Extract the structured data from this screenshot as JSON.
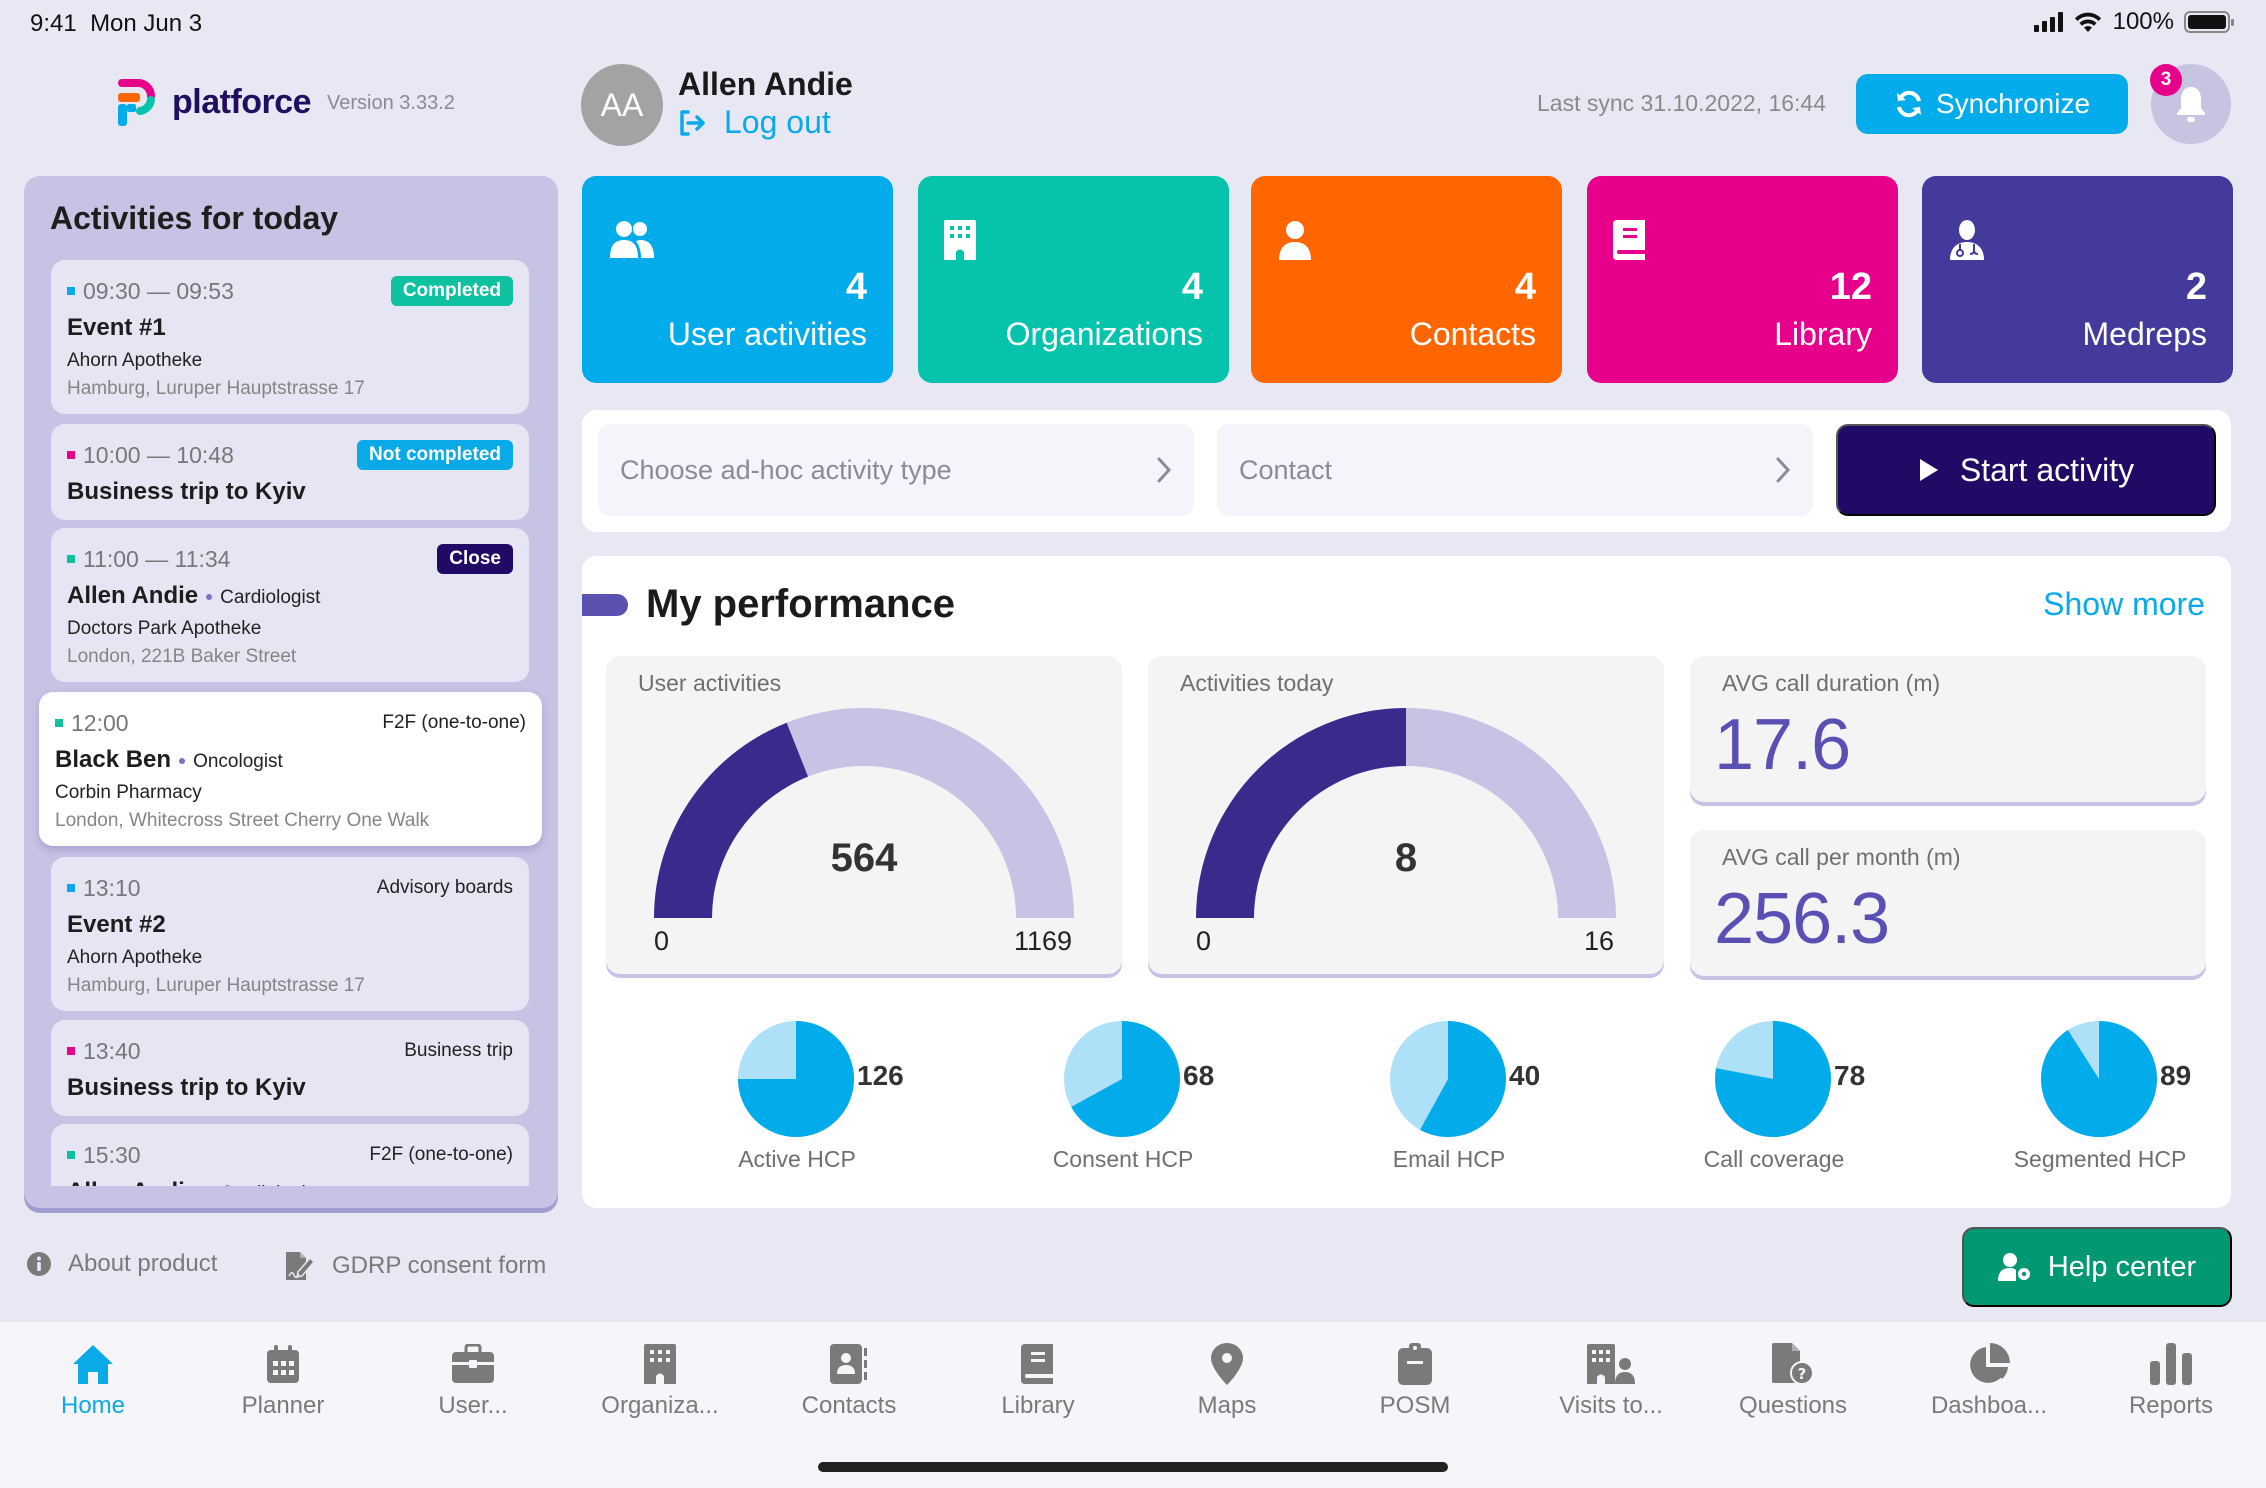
{
  "status_bar": {
    "time": "9:41",
    "date": "Mon Jun 3",
    "battery": "100%"
  },
  "header": {
    "brand": "platforce",
    "version": "Version 3.33.2",
    "user_initials": "AA",
    "user_name": "Allen Andie",
    "logout_label": "Log out",
    "last_sync": "Last sync 31.10.2022, 16:44",
    "sync_label": "Synchronize",
    "notification_count": "3"
  },
  "activities_panel": {
    "title": "Activities for today",
    "items": [
      {
        "time": "09:30 — 09:53",
        "color": "#0aa9e8",
        "badge": "Completed",
        "badge_color": "#0ec2a1",
        "title": "Event #1",
        "specialty": "",
        "org": "Ahorn Apotheke",
        "address": "Hamburg, Luruper Hauptstrasse 17"
      },
      {
        "time": "10:00 — 10:48",
        "color": "#e6008a",
        "badge": "Not completed",
        "badge_color": "#0aa9e8",
        "title": "Business trip to Kyiv",
        "specialty": "",
        "org": "",
        "address": ""
      },
      {
        "time": "11:00 — 11:34",
        "color": "#0ec2a1",
        "badge": "Close",
        "badge_color": "#210a66",
        "title": "Allen Andie",
        "specialty": "Cardiologist",
        "org": "Doctors Park Apotheke",
        "address": "London, 221B Baker Street"
      },
      {
        "time": "12:00",
        "color": "#0ec2a1",
        "type": "F2F (one-to-one)",
        "title": "Black Ben",
        "specialty": "Oncologist",
        "org": "Corbin Pharmacy",
        "address": "London, Whitecross Street Cherry One Walk",
        "selected": true
      },
      {
        "time": "13:10",
        "color": "#0aa9e8",
        "type": "Advisory boards",
        "title": "Event #2",
        "specialty": "",
        "org": "Ahorn Apotheke",
        "address": "Hamburg, Luruper Hauptstrasse 17"
      },
      {
        "time": "13:40",
        "color": "#e6008a",
        "type": "Business trip",
        "title": "Business trip to Kyiv",
        "specialty": "",
        "org": "",
        "address": ""
      },
      {
        "time": "15:30",
        "color": "#0ec2a1",
        "type": "F2F (one-to-one)",
        "title": "Allen Andie",
        "specialty": "Cardiologist",
        "org": "",
        "address": ""
      }
    ]
  },
  "tiles": [
    {
      "icon": "users-icon",
      "count": "4",
      "label": "User activities",
      "color": "#02abe9"
    },
    {
      "icon": "building-icon",
      "count": "4",
      "label": "Organizations",
      "color": "#06c4ab"
    },
    {
      "icon": "user-icon",
      "count": "4",
      "label": "Contacts",
      "color": "#ff6600"
    },
    {
      "icon": "book-icon",
      "count": "12",
      "label": "Library",
      "color": "#e6008a"
    },
    {
      "icon": "doctor-icon",
      "count": "2",
      "label": "Medreps",
      "color": "#433a9b"
    }
  ],
  "action_bar": {
    "activity_type_placeholder": "Choose ad-hoc activity type",
    "contact_placeholder": "Contact",
    "start_label": "Start activity"
  },
  "performance": {
    "title": "My performance",
    "show_more": "Show more",
    "metrics": [
      {
        "label": "AVG call duration (m)",
        "value": "17.6"
      },
      {
        "label": "AVG call per month (m)",
        "value": "256.3"
      }
    ]
  },
  "chart_data": [
    {
      "type": "gauge",
      "title": "User activities",
      "value": 564,
      "min": 0,
      "max": 1169,
      "min_label": "0",
      "max_label": "1169",
      "value_label": "564",
      "displayed_fill_fraction": 0.38
    },
    {
      "type": "gauge",
      "title": "Activities today",
      "value": 8,
      "min": 0,
      "max": 16,
      "min_label": "0",
      "max_label": "16",
      "value_label": "8",
      "displayed_fill_fraction": 0.5
    },
    {
      "type": "pie",
      "title": "Active HCP",
      "value_label": "126",
      "filled_fraction": 0.75
    },
    {
      "type": "pie",
      "title": "Consent HCP",
      "value_label": "68",
      "filled_fraction": 0.67
    },
    {
      "type": "pie",
      "title": "Email HCP",
      "value_label": "40",
      "filled_fraction": 0.58
    },
    {
      "type": "pie",
      "title": "Call coverage",
      "value_label": "78",
      "filled_fraction": 0.78
    },
    {
      "type": "pie",
      "title": "Segmented HCP",
      "value_label": "89",
      "filled_fraction": 0.91
    }
  ],
  "footer": {
    "about_label": "About product",
    "gdpr_label": "GDRP consent form",
    "help_label": "Help center"
  },
  "bottom_nav": [
    {
      "label": "Home",
      "icon": "home-icon",
      "active": true
    },
    {
      "label": "Planner",
      "icon": "calendar-icon"
    },
    {
      "label": "User...",
      "icon": "briefcase-icon"
    },
    {
      "label": "Organiza...",
      "icon": "building-icon"
    },
    {
      "label": "Contacts",
      "icon": "contact-book-icon"
    },
    {
      "label": "Library",
      "icon": "book-icon"
    },
    {
      "label": "Maps",
      "icon": "map-pin-icon"
    },
    {
      "label": "POSM",
      "icon": "clipboard-icon"
    },
    {
      "label": "Visits to...",
      "icon": "building-user-icon"
    },
    {
      "label": "Questions",
      "icon": "question-file-icon"
    },
    {
      "label": "Dashboa...",
      "icon": "pie-chart-icon"
    },
    {
      "label": "Reports",
      "icon": "bar-chart-icon"
    }
  ],
  "colors": {
    "accent": "#0aa9e8",
    "primary_dark": "#210a66",
    "gauge_fill": "#3a2a8c",
    "gauge_track": "#c6c3e4",
    "pie_fill": "#02abe9",
    "pie_rest": "#aee0f7"
  }
}
